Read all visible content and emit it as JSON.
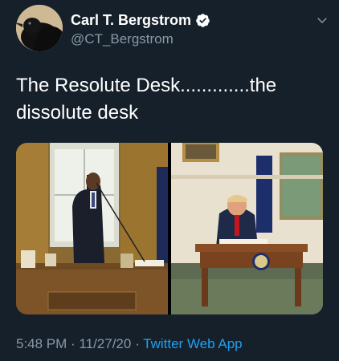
{
  "tweet": {
    "display_name": "Carl T. Bergstrom",
    "handle": "@CT_Bergstrom",
    "text_line1": "The Resolute Desk.............the",
    "text_line2": "dissolute desk",
    "time": "5:48 PM",
    "separator1": " · ",
    "date": "11/27/20",
    "separator2": " · ",
    "source": "Twitter Web App"
  },
  "icons": {
    "verified": "verified-badge-icon",
    "caret": "chevron-down-icon"
  },
  "colors": {
    "background": "#15202b",
    "text": "#ffffff",
    "muted": "#8899a6",
    "link": "#1da1f2"
  }
}
